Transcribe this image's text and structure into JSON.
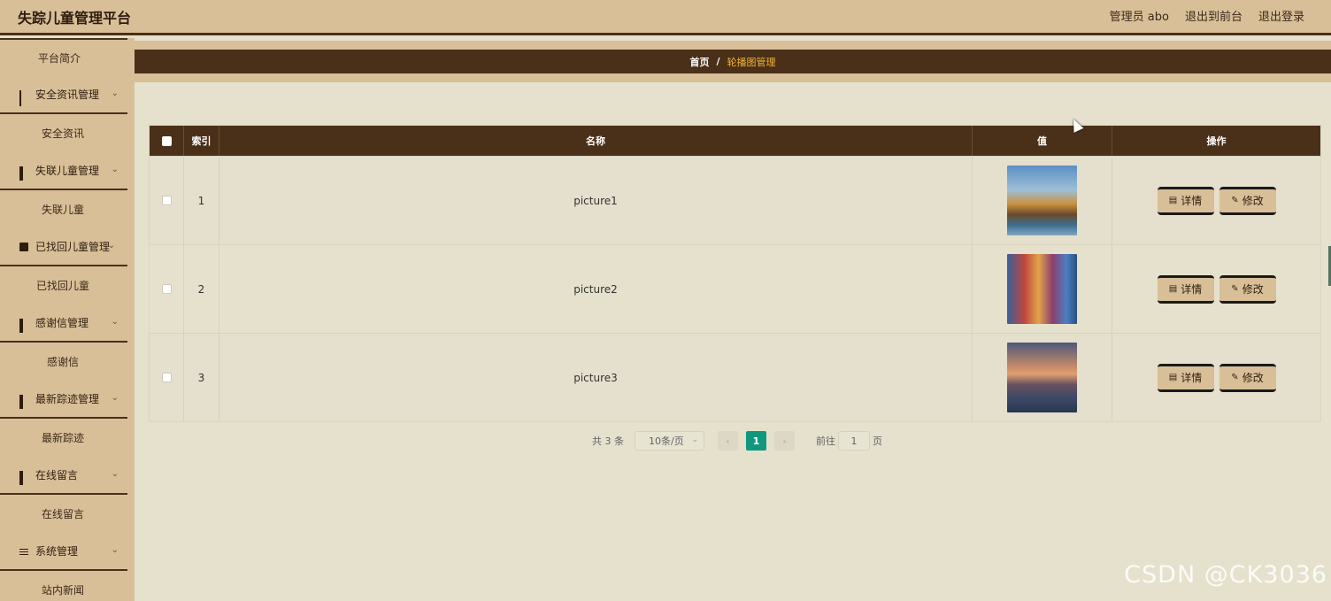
{
  "header": {
    "title": "失踪儿童管理平台",
    "admin_label": "管理员 abo",
    "to_front": "退出到前台",
    "logout": "退出登录"
  },
  "sidebar": {
    "items": [
      {
        "type": "sub",
        "label": "平台简介"
      },
      {
        "type": "group",
        "label": "安全资讯管理",
        "icon": "grid9-icon"
      },
      {
        "type": "sub",
        "label": "安全资讯"
      },
      {
        "type": "group",
        "label": "失联儿童管理",
        "icon": "grid-icon"
      },
      {
        "type": "sub",
        "label": "失联儿童"
      },
      {
        "type": "group",
        "label": "已找回儿童管理",
        "icon": "clipboard-icon"
      },
      {
        "type": "sub",
        "label": "已找回儿童"
      },
      {
        "type": "group",
        "label": "感谢信管理",
        "icon": "grid-icon"
      },
      {
        "type": "sub",
        "label": "感谢信"
      },
      {
        "type": "group",
        "label": "最新踪迹管理",
        "icon": "grid-icon"
      },
      {
        "type": "sub",
        "label": "最新踪迹"
      },
      {
        "type": "group",
        "label": "在线留言",
        "icon": "grid-icon"
      },
      {
        "type": "sub",
        "label": "在线留言"
      },
      {
        "type": "group",
        "label": "系统管理",
        "icon": "sliders-icon"
      },
      {
        "type": "sub",
        "label": "站内新闻"
      }
    ]
  },
  "breadcrumb": {
    "home": "首页",
    "separator": "/",
    "current": "轮播图管理"
  },
  "table": {
    "headers": {
      "index": "索引",
      "name": "名称",
      "value": "值",
      "ops": "操作"
    },
    "rows": [
      {
        "index": "1",
        "name": "picture1"
      },
      {
        "index": "2",
        "name": "picture2"
      },
      {
        "index": "3",
        "name": "picture3"
      }
    ],
    "detail_label": "详情",
    "edit_label": "修改"
  },
  "pagination": {
    "total": "共 3 条",
    "page_size": "10条/页",
    "current_page": "1",
    "goto_label": "前往",
    "goto_value": "1",
    "page_suffix": "页"
  },
  "watermark": "CSDN @CK3036",
  "colors": {
    "brand_dark": "#4a3019",
    "tan": "#d9bf98",
    "background": "#e5e1cc",
    "accent_gold": "#f2b233",
    "page_active": "#11977e"
  }
}
